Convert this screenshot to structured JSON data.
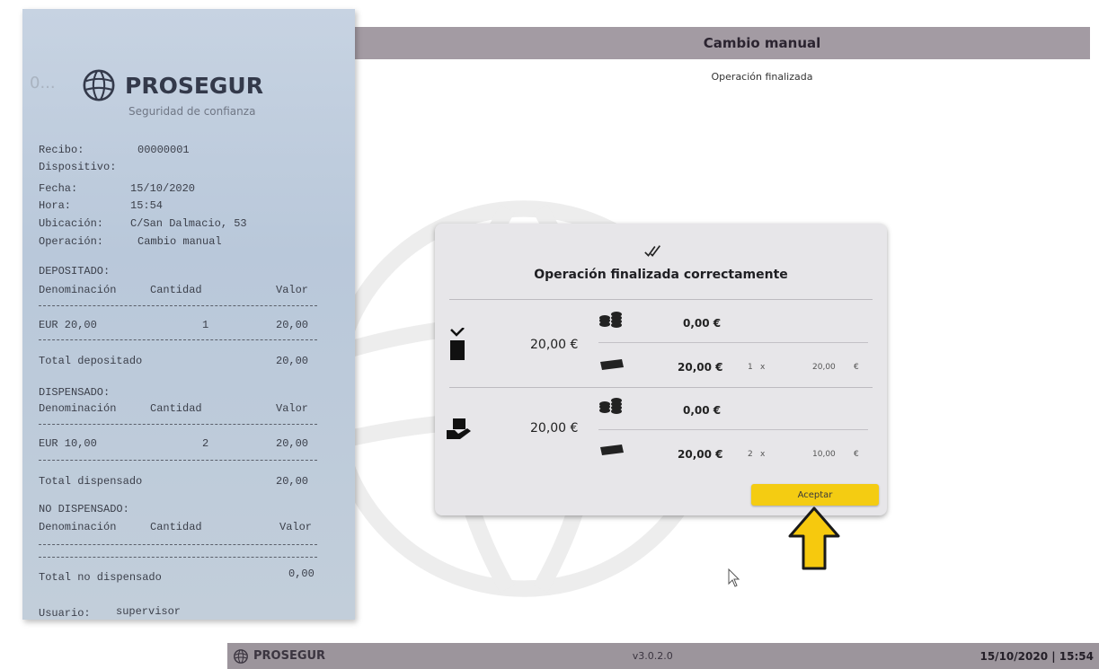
{
  "app": {
    "title": "Cambio manual",
    "subtitle": "Operación finalizada",
    "footer": {
      "brand": "PROSEGUR",
      "version": "v3.0.2.0",
      "datetime": "15/10/2020 | 15:54"
    }
  },
  "dialog": {
    "title": "Operación finalizada correctamente",
    "sections": [
      {
        "icon": "deposit-slot-icon",
        "total": "20,00 €",
        "coins_amount": "0,00 €",
        "notes_amount": "20,00 €",
        "notes_count": "1",
        "notes_times": "x",
        "notes_denomination": "20,00",
        "currency_symbol": "€"
      },
      {
        "icon": "hand-dispense-icon",
        "total": "20,00 €",
        "coins_amount": "0,00 €",
        "notes_amount": "20,00 €",
        "notes_count": "2",
        "notes_times": "x",
        "notes_denomination": "10,00",
        "currency_symbol": "€"
      }
    ],
    "accept_label": "Aceptar"
  },
  "receipt": {
    "faint_mark": "0...",
    "brand": "PROSEGUR",
    "tagline": "Seguridad de confianza",
    "fields": [
      {
        "label": "Recibo:",
        "value": "00000001"
      },
      {
        "label": "Dispositivo:",
        "value": ""
      },
      {
        "label": "Fecha:",
        "value": "15/10/2020"
      },
      {
        "label": "Hora:",
        "value": "15:54"
      },
      {
        "label": "Ubicación:",
        "value": "C/San Dalmacio, 53"
      },
      {
        "label": "Operación:",
        "value": "Cambio manual"
      }
    ],
    "deposited": {
      "heading": "DEPOSITADO:",
      "col_denomination": "Denominación",
      "col_quantity": "Cantidad",
      "col_value": "Valor",
      "row_denomination": "EUR 20,00",
      "row_quantity": "1",
      "row_value": "20,00",
      "total_label": "Total depositado",
      "total_value": "20,00"
    },
    "dispensed": {
      "heading": "DISPENSADO:",
      "col_denomination": "Denominación",
      "col_quantity": "Cantidad",
      "col_value": "Valor",
      "row_denomination": "EUR 10,00",
      "row_quantity": "2",
      "row_value": "20,00",
      "total_label": "Total dispensado",
      "total_value": "20,00"
    },
    "not_dispensed": {
      "heading": "NO DISPENSADO:",
      "col_denomination": "Denominación",
      "col_quantity": "Cantidad",
      "col_value": "Valor",
      "total_label": "Total no dispensado",
      "total_value": "0,00"
    },
    "user_label": "Usuario:",
    "user_value": "supervisor"
  },
  "colors": {
    "header": "#a39ba3",
    "footer": "#9c959c",
    "accept_button": "#f4cc12",
    "arrow": "#f6c90e",
    "receipt_paper": "#c2ceda"
  }
}
